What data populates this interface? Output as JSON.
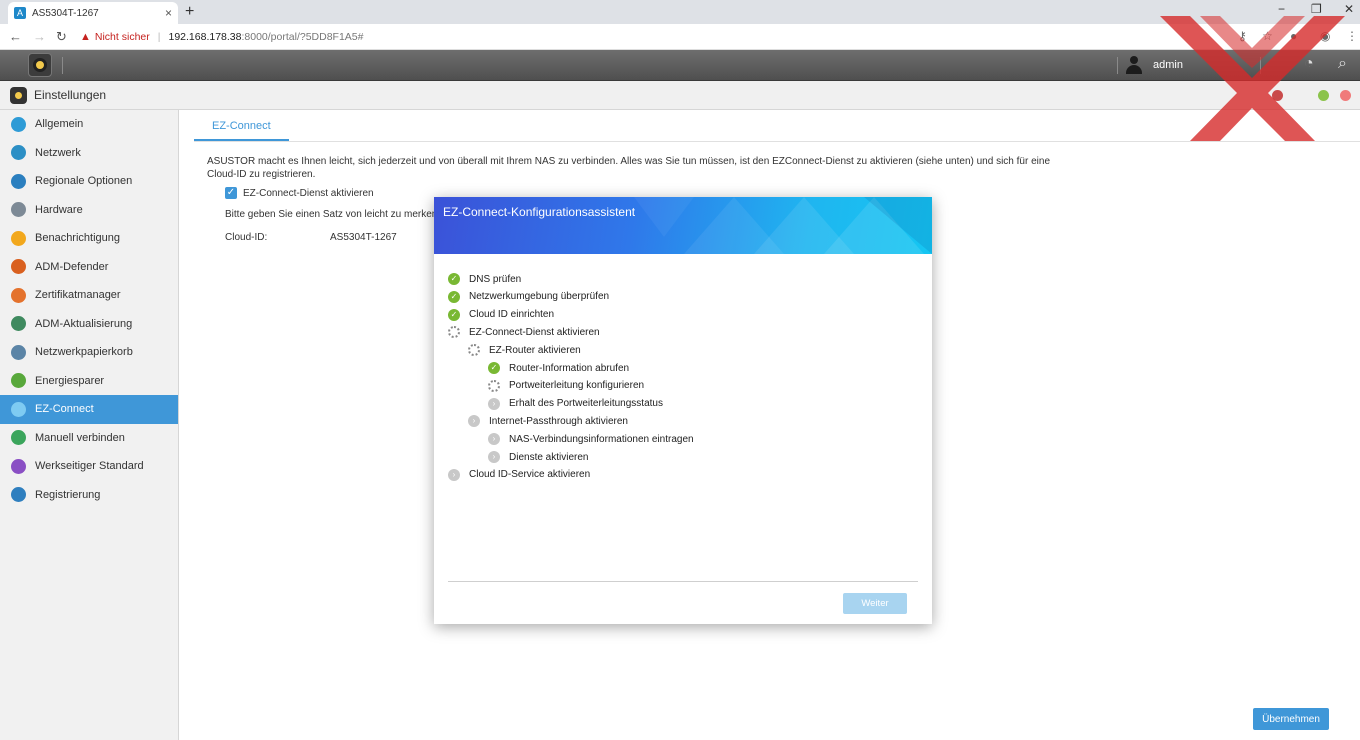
{
  "browser": {
    "tab_title": "AS5304T-1267",
    "new_tab": "+",
    "tab_close": "×",
    "security_label": "Nicht sicher",
    "url_host": "192.168.178.38",
    "url_path": ":8000/portal/?5DD8F1A5#",
    "win_min": "−",
    "win_restore": "❐",
    "win_close": "✕"
  },
  "topbar": {
    "username": "admin"
  },
  "app": {
    "title": "Einstellungen"
  },
  "sidebar": {
    "items": [
      {
        "label": "Allgemein",
        "color": "#2e9bd6",
        "icon": "general-icon"
      },
      {
        "label": "Netzwerk",
        "color": "#2c8fc5",
        "icon": "globe-icon"
      },
      {
        "label": "Regionale Optionen",
        "color": "#2b7fbf",
        "icon": "location-icon"
      },
      {
        "label": "Hardware",
        "color": "#7d8a96",
        "icon": "wrench-icon"
      },
      {
        "label": "Benachrichtigung",
        "color": "#f2a81d",
        "icon": "alert-icon"
      },
      {
        "label": "ADM-Defender",
        "color": "#d9601f",
        "icon": "firewall-icon"
      },
      {
        "label": "Zertifikatmanager",
        "color": "#e4722d",
        "icon": "certificate-icon"
      },
      {
        "label": "ADM-Aktualisierung",
        "color": "#3f8a5f",
        "icon": "update-icon"
      },
      {
        "label": "Netzwerkpapierkorb",
        "color": "#5b84a6",
        "icon": "recycle-bin-icon"
      },
      {
        "label": "Energiesparer",
        "color": "#58a83b",
        "icon": "energy-icon"
      },
      {
        "label": "EZ-Connect",
        "color": "#7ecbf2",
        "icon": "cloud-icon"
      },
      {
        "label": "Manuell verbinden",
        "color": "#3ba55c",
        "icon": "connect-icon"
      },
      {
        "label": "Werkseitiger Standard",
        "color": "#8a4fc4",
        "icon": "reset-icon"
      },
      {
        "label": "Registrierung",
        "color": "#2f7fbf",
        "icon": "register-icon"
      }
    ],
    "active_index": 10
  },
  "main": {
    "tab": "EZ-Connect",
    "description": "ASUSTOR macht es Ihnen leicht, sich jederzeit und von überall mit Ihrem NAS zu verbinden. Alles was Sie tun müssen, ist den EZConnect-Dienst zu aktivieren (siehe unten) und sich für eine Cloud-ID zu registrieren.",
    "checkbox_label": "EZ-Connect-Dienst aktivieren",
    "checkbox_checked": true,
    "hint": "Bitte geben Sie einen Satz von leicht zu merkenden",
    "cloud_id_label": "Cloud-ID:",
    "cloud_id_value": "AS5304T-1267",
    "apply_button": "Übernehmen"
  },
  "dialog": {
    "title": "EZ-Connect-Konfigurationsassistent",
    "steps": [
      {
        "label": "DNS prüfen",
        "status": "done",
        "level": 0
      },
      {
        "label": "Netzwerkumgebung überprüfen",
        "status": "done",
        "level": 0
      },
      {
        "label": "Cloud ID einrichten",
        "status": "done",
        "level": 0
      },
      {
        "label": "EZ-Connect-Dienst aktivieren",
        "status": "running",
        "level": 0
      },
      {
        "label": "EZ-Router aktivieren",
        "status": "running",
        "level": 1
      },
      {
        "label": "Router-Information abrufen",
        "status": "done",
        "level": 2
      },
      {
        "label": "Portweiterleitung konfigurieren",
        "status": "running",
        "level": 2
      },
      {
        "label": "Erhalt des Portweiterleitungsstatus",
        "status": "pending",
        "level": 2
      },
      {
        "label": "Internet-Passthrough aktivieren",
        "status": "pending",
        "level": 1
      },
      {
        "label": "NAS-Verbindungsinformationen eintragen",
        "status": "pending",
        "level": 2
      },
      {
        "label": "Dienste aktivieren",
        "status": "pending",
        "level": 2
      },
      {
        "label": "Cloud ID-Service aktivieren",
        "status": "pending",
        "level": 0
      }
    ],
    "next_button": "Weiter"
  },
  "colors": {
    "accent": "#3f97d8",
    "done": "#79b833",
    "pending": "#c8c8c8",
    "watermark": "#d62b2b"
  }
}
